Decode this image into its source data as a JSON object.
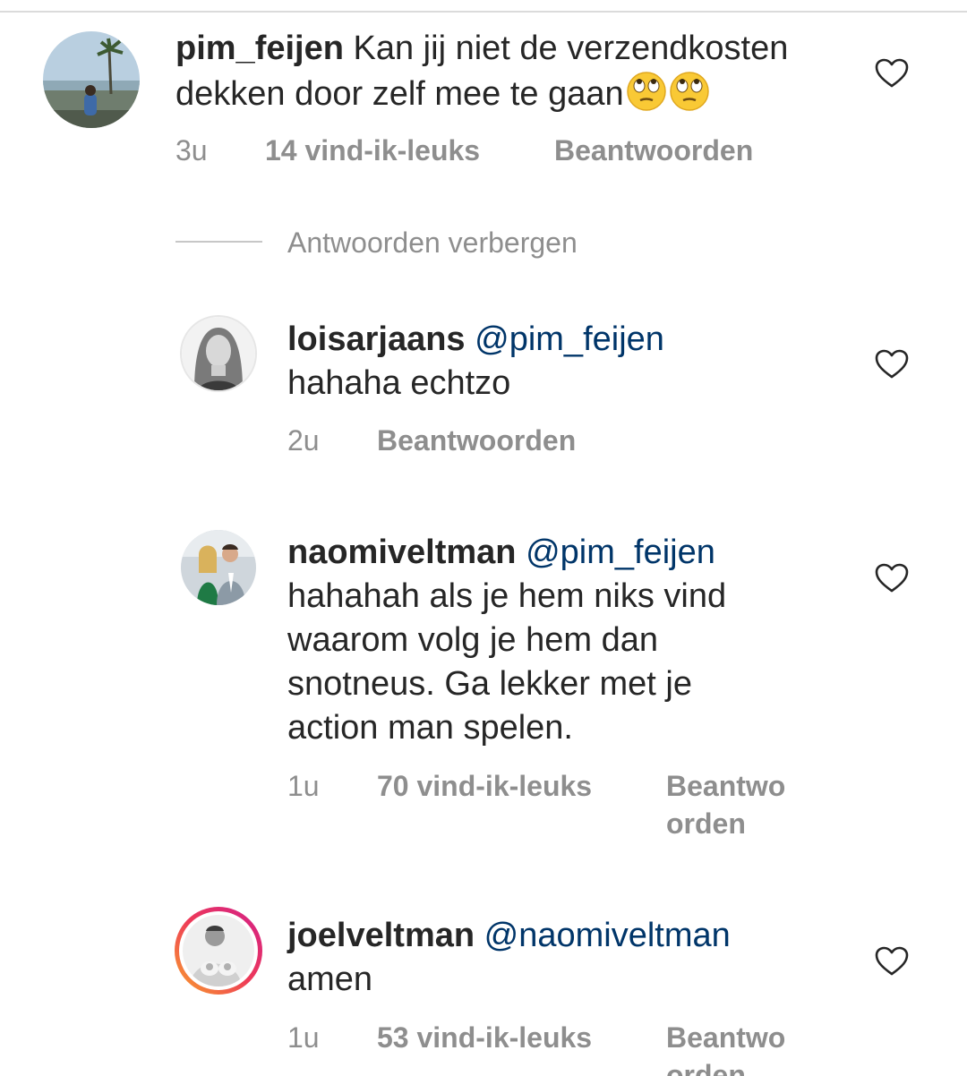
{
  "comments": [
    {
      "username": "pim_feijen",
      "mention": "",
      "text": "Kan jij niet de verzendkosten dekken door zelf mee te gaan",
      "emoji": [
        "eye-roll-emoji",
        "eye-roll-emoji"
      ],
      "time": "3u",
      "likes": "14 vind-ik-leuks",
      "reply": "Beantwoorden"
    }
  ],
  "hide_replies": "Antwoorden verbergen",
  "replies": [
    {
      "username": "loisarjaans",
      "mention": "@pim_feijen",
      "text_line1": "hahaha echtzo",
      "time": "2u",
      "likes": "",
      "reply": "Beantwoorden"
    },
    {
      "username": "naomiveltman",
      "mention": "@pim_feijen",
      "text_line1": "hahahah als je hem niks vind",
      "text_line2": "waarom volg je hem dan",
      "text_line3": "snotneus. Ga lekker met je",
      "text_line4": "action man spelen.",
      "time": "1u",
      "likes": "70 vind-ik-leuks",
      "reply_line1": "Beantwo",
      "reply_line2": "orden"
    },
    {
      "username": "joelveltman",
      "mention": "@naomiveltman",
      "text_line1": "amen",
      "time": "1u",
      "likes": "53 vind-ik-leuks",
      "reply_line1": "Beantwo",
      "reply_line2": "orden"
    }
  ],
  "colors": {
    "text": "#262626",
    "meta": "#8e8e8e",
    "mention": "#003569",
    "story_ring_start": "#f9a42b",
    "story_ring_end": "#d21f8a"
  }
}
